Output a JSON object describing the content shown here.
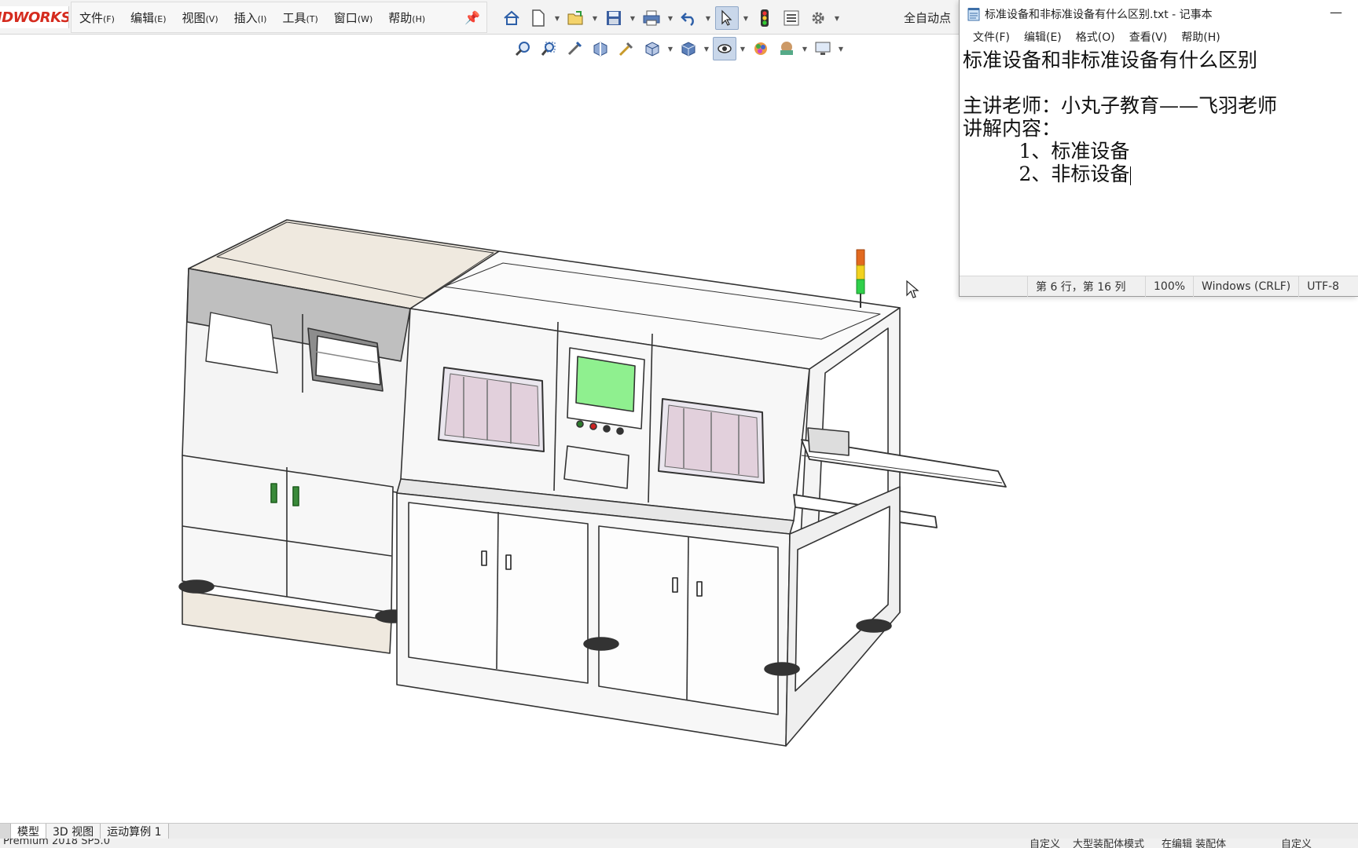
{
  "solidworks": {
    "logo_text": "IDWORKS",
    "menu": [
      {
        "label": "文件",
        "key": "(F)"
      },
      {
        "label": "编辑",
        "key": "(E)"
      },
      {
        "label": "视图",
        "key": "(V)"
      },
      {
        "label": "插入",
        "key": "(I)"
      },
      {
        "label": "工具",
        "key": "(T)"
      },
      {
        "label": "窗口",
        "key": "(W)"
      },
      {
        "label": "帮助",
        "key": "(H)"
      }
    ],
    "auto_label": "全自动点",
    "toolbar_icons": [
      "home-icon",
      "new-document-icon",
      "open-folder-icon",
      "save-icon",
      "print-icon",
      "undo-icon",
      "select-pointer-icon",
      "traffic-light-icon",
      "options-list-icon",
      "settings-gear-icon"
    ],
    "view_toolbar_icons": [
      "zoom-to-fit-icon",
      "zoom-area-icon",
      "previous-view-icon",
      "section-view-icon",
      "dynamic-annotation-icon",
      "view-orientation-icon",
      "display-style-icon",
      "hide-show-icon",
      "edit-appearance-icon",
      "apply-scene-icon",
      "view-settings-icon"
    ],
    "tabs": [
      "模型",
      "3D 视图",
      "运动算例 1"
    ],
    "status": {
      "version": "Premium 2018 SP5.0",
      "custom1": "自定义",
      "mode": "大型装配体模式",
      "editing": "在编辑 装配体",
      "custom2": "自定义"
    },
    "colors": {
      "logo_red": "#d52b1e",
      "screen_green": "#8ff08f",
      "cabinet_white": "#f7f7f7",
      "top_panel_beige": "#efe9df"
    }
  },
  "notepad": {
    "title": "标准设备和非标准设备有什么区别.txt - 记事本",
    "menu": [
      "文件(F)",
      "编辑(E)",
      "格式(O)",
      "查看(V)",
      "帮助(H)"
    ],
    "lines": [
      "标准设备和非标准设备有什么区别",
      "",
      "主讲老师：小丸子教育——飞羽老师",
      "讲解内容：",
      "         1、标准设备",
      "         2、非标设备"
    ],
    "status": {
      "position": "第 6 行，第 16 列",
      "zoom": "100%",
      "line_ending": "Windows (CRLF)",
      "encoding": "UTF-8"
    }
  }
}
